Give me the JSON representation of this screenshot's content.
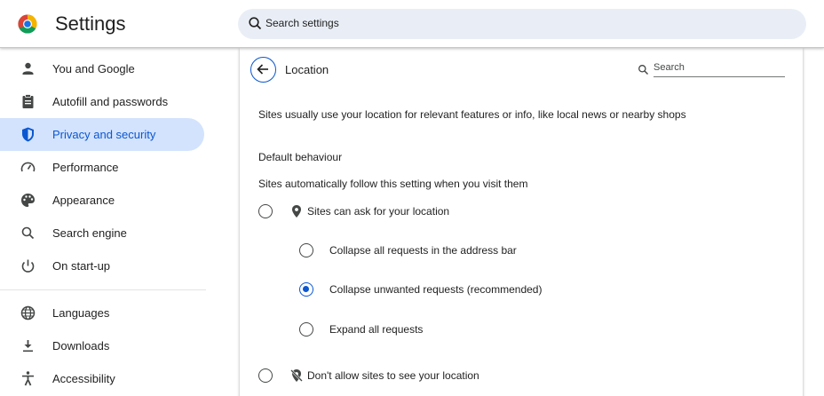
{
  "header": {
    "app_title": "Settings",
    "search_placeholder": "Search settings"
  },
  "sidebar": {
    "items": [
      {
        "label": "You and Google",
        "icon": "person-icon"
      },
      {
        "label": "Autofill and passwords",
        "icon": "clipboard-icon"
      },
      {
        "label": "Privacy and security",
        "icon": "shield-icon",
        "active": true
      },
      {
        "label": "Performance",
        "icon": "speedometer-icon"
      },
      {
        "label": "Appearance",
        "icon": "palette-icon"
      },
      {
        "label": "Search engine",
        "icon": "search-icon"
      },
      {
        "label": "On start-up",
        "icon": "power-icon"
      },
      {
        "label": "Languages",
        "icon": "globe-icon"
      },
      {
        "label": "Downloads",
        "icon": "download-icon"
      },
      {
        "label": "Accessibility",
        "icon": "accessibility-icon"
      }
    ]
  },
  "page": {
    "title": "Location",
    "search_placeholder": "Search",
    "description": "Sites usually use your location for relevant features or info, like local news or nearby shops",
    "default_behaviour": {
      "heading": "Default behaviour",
      "subheading": "Sites automatically follow this setting when you visit them",
      "options": {
        "ask": "Sites can ask for your location",
        "collapse_all": "Collapse all requests in the address bar",
        "collapse_unwanted": "Collapse unwanted requests (recommended)",
        "expand_all": "Expand all requests",
        "block": "Don't allow sites to see your location"
      },
      "selected": "collapse_unwanted"
    }
  },
  "colors": {
    "accent": "#0b57d0",
    "active_bg": "#d3e3fd",
    "search_bg": "#e9eef6"
  }
}
